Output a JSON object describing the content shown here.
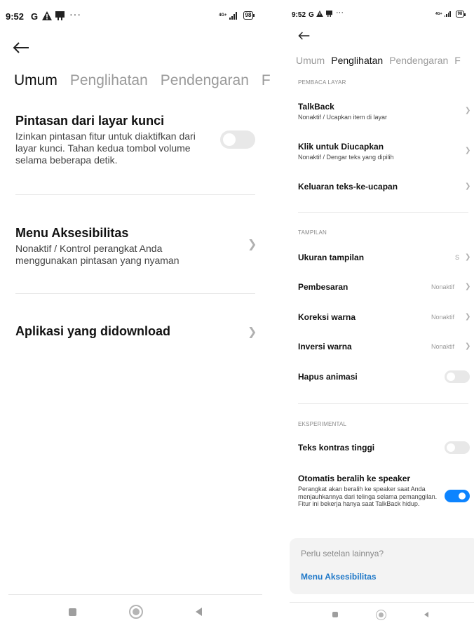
{
  "left": {
    "status": {
      "time": "9:52",
      "g": "G",
      "network": "4G+",
      "battery": "98"
    },
    "tabs": [
      "Umum",
      "Penglihatan",
      "Pendengaran",
      "F"
    ],
    "items": [
      {
        "title": "Pintasan dari layar kunci",
        "subtitle": "Izinkan pintasan fitur untuk diaktifkan dari layar kunci. Tahan kedua tombol volume selama beberapa detik.",
        "toggle": "off"
      },
      {
        "title": "Menu Aksesibilitas",
        "subtitle": "Nonaktif / Kontrol perangkat Anda menggunakan pintasan yang nyaman"
      },
      {
        "title": "Aplikasi yang didownload"
      }
    ]
  },
  "right": {
    "status": {
      "time": "9:52",
      "g": "G",
      "network": "4G+",
      "battery": "98"
    },
    "tabs": [
      "Umum",
      "Penglihatan",
      "Pendengaran",
      "F"
    ],
    "sections": {
      "screen_reader": "PEMBACA LAYAR",
      "display": "TAMPILAN",
      "experimental": "EKSPERIMENTAL"
    },
    "items": {
      "talkback": {
        "title": "TalkBack",
        "subtitle": "Nonaktif / Ucapkan item di layar"
      },
      "select_to_speak": {
        "title": "Klik untuk Diucapkan",
        "subtitle": "Nonaktif / Dengar teks yang dipilih"
      },
      "tts": {
        "title": "Keluaran teks-ke-ucapan"
      },
      "display_size": {
        "title": "Ukuran tampilan",
        "value": "S"
      },
      "magnification": {
        "title": "Pembesaran",
        "value": "Nonaktif"
      },
      "color_correction": {
        "title": "Koreksi warna",
        "value": "Nonaktif"
      },
      "color_inversion": {
        "title": "Inversi warna",
        "value": "Nonaktif"
      },
      "remove_animations": {
        "title": "Hapus animasi",
        "toggle": "off"
      },
      "high_contrast": {
        "title": "Teks kontras tinggi",
        "toggle": "off"
      },
      "auto_speaker": {
        "title": "Otomatis beralih ke speaker",
        "subtitle": "Perangkat akan beralih ke speaker saat Anda menjauhkannya dari telinga selama pemanggilan. Fitur ini bekerja hanya saat TalkBack hidup.",
        "toggle": "on"
      }
    },
    "card": {
      "question": "Perlu setelan lainnya?",
      "link": "Menu Aksesibilitas"
    }
  },
  "colors": {
    "accent": "#0d84ff",
    "muted": "#9a9a9a",
    "toggle_off": "#e8e8e8"
  }
}
